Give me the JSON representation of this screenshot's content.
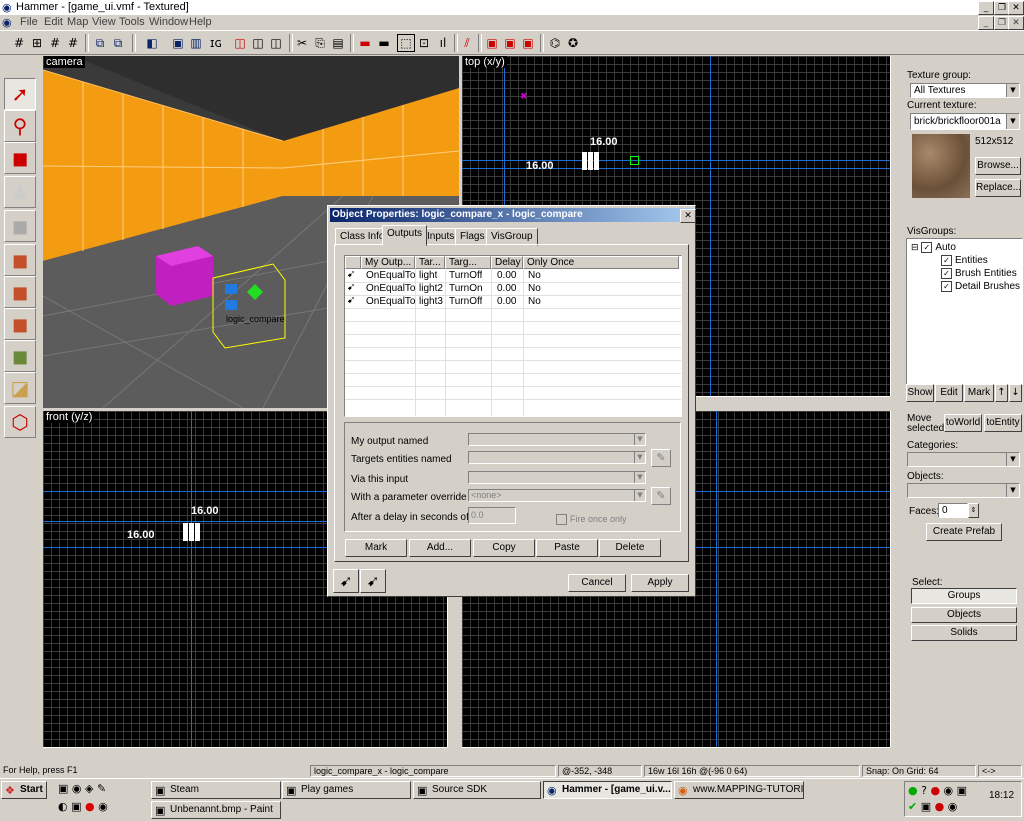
{
  "window": {
    "title": "Hammer - [game_ui.vmf - Textured]"
  },
  "menu": [
    "File",
    "Edit",
    "Map",
    "View",
    "Tools",
    "Window",
    "Help"
  ],
  "viewports": {
    "camera": {
      "label": "camera",
      "entity_label": "logic_compare"
    },
    "top": {
      "label": "top (x/y)",
      "coord_a": "16.00",
      "coord_b": "16.00"
    },
    "front": {
      "label": "front (y/z)",
      "coord_a": "16.00",
      "coord_b": "16.00"
    }
  },
  "dialog": {
    "title": "Object Properties: logic_compare_x - logic_compare",
    "tabs": [
      "Class Info",
      "Outputs",
      "Inputs",
      "Flags",
      "VisGroup"
    ],
    "active_tab": "Outputs",
    "columns": [
      "My Outp...",
      "Tar...",
      "Targ...",
      "Delay",
      "Only Once"
    ],
    "rows": [
      {
        "output": "OnEqualTo",
        "target": "light",
        "input": "TurnOff",
        "delay": "0.00",
        "once": "No"
      },
      {
        "output": "OnEqualTo",
        "target": "light2",
        "input": "TurnOn",
        "delay": "0.00",
        "once": "No"
      },
      {
        "output": "OnEqualTo",
        "target": "light3",
        "input": "TurnOff",
        "delay": "0.00",
        "once": "No"
      }
    ],
    "fields": {
      "my_output": "My output named",
      "targets": "Targets entities named",
      "via_input": "Via this input",
      "param": "With a parameter override of",
      "param_value": "<none>",
      "delay": "After a delay in seconds of",
      "delay_value": "0.0",
      "fire_once": "Fire once only"
    },
    "buttons": {
      "mark": "Mark",
      "add": "Add...",
      "copy": "Copy",
      "paste": "Paste",
      "delete": "Delete",
      "cancel": "Cancel",
      "apply": "Apply"
    }
  },
  "right_panel": {
    "texture_group_label": "Texture group:",
    "texture_group": "All Textures",
    "current_texture_label": "Current texture:",
    "current_texture": "brick/brickfloor001a",
    "texture_size": "512x512",
    "browse": "Browse...",
    "replace": "Replace...",
    "visgroups_label": "VisGroups:",
    "visgroups": {
      "root": "Auto",
      "children": [
        "Entities",
        "Brush Entities",
        "Detail Brushes"
      ]
    },
    "vis_buttons": [
      "Show",
      "Edit",
      "Mark"
    ],
    "move_selected": "Move selected:",
    "to_world": "toWorld",
    "to_entity": "toEntity",
    "categories_label": "Categories:",
    "objects_label": "Objects:",
    "faces_label": "Faces:",
    "faces_value": "0",
    "create_prefab": "Create Prefab",
    "select_label": "Select:",
    "select_buttons": [
      "Groups",
      "Objects",
      "Solids"
    ]
  },
  "status": {
    "help": "For Help, press F1",
    "selection": "logic_compare_x - logic_compare",
    "cursor": "@-352, -348",
    "size": "16w 16l 16h @(-96 0 64)",
    "snap": "Snap: On Grid: 64",
    "extra": "<->"
  },
  "taskbar": {
    "start": "Start",
    "tasks": [
      "Steam",
      "Play games",
      "Source SDK",
      "Hammer - [game_ui.v...",
      "www.MAPPING-TUTORIA...",
      "Unbenannt.bmp - Paint"
    ],
    "clock": "18:12"
  },
  "colors": {
    "wall": "#f39c12",
    "selection": "#ffff00",
    "grid_line": "#1a6fd8",
    "magenta_block": "#cc22cc"
  }
}
